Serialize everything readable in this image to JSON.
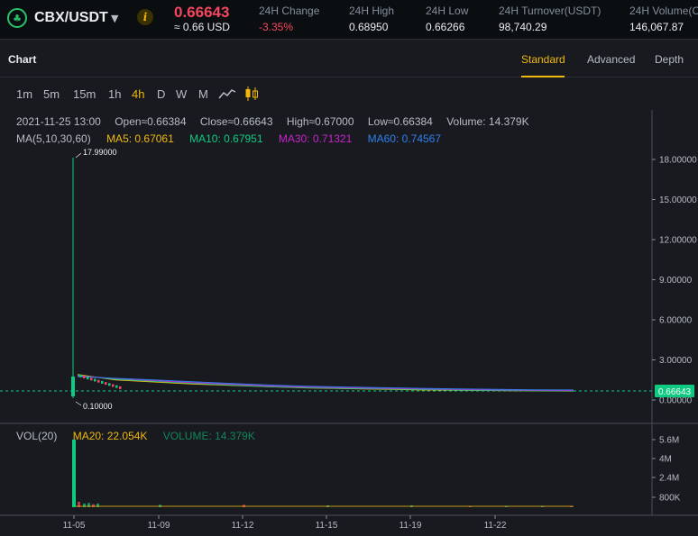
{
  "header": {
    "pair": "CBX/USDT",
    "pair_caret": "▼",
    "info_glyph": "i",
    "logo_glyph": "♣",
    "last_price": "0.66643",
    "last_price_usd": "≈ 0.66 USD",
    "stats": [
      {
        "label": "24H Change",
        "value": "-3.35%"
      },
      {
        "label": "24H High",
        "value": "0.68950"
      },
      {
        "label": "24H Low",
        "value": "0.66266"
      },
      {
        "label": "24H Turnover(USDT)",
        "value": "98,740.29"
      },
      {
        "label": "24H Volume(C",
        "value": "146,067.87"
      }
    ],
    "colors": {
      "up": "#0ecb81",
      "down": "#f6465d",
      "accent": "#f0b90b"
    }
  },
  "chart_panel": {
    "title": "Chart",
    "tabs": [
      "Standard",
      "Advanced",
      "Depth"
    ],
    "active_tab": "Standard"
  },
  "toolbar": {
    "intervals": [
      "1m",
      "5m",
      "15m",
      "1h",
      "4h",
      "D",
      "W",
      "M"
    ],
    "active_interval": "4h",
    "icons": [
      "line-chart-icon",
      "candlestick-icon"
    ]
  },
  "legend": {
    "time": "2021-11-25 13:00",
    "open": "Open≈0.66384",
    "close": "Close≈0.66643",
    "high": "High≈0.67000",
    "low": "Low≈0.66384",
    "volume": "Volume: 14.379K",
    "ma_label": "MA(5,10,30,60)",
    "ma5": "MA5: 0.67061",
    "ma10": "MA10: 0.67951",
    "ma30": "MA30: 0.71321",
    "ma60": "MA60: 0.74567",
    "ma_colors": {
      "ma5": "#f0b90b",
      "ma10": "#0ecb81",
      "ma30": "#c924c9",
      "ma60": "#2f80ed"
    }
  },
  "volume_legend": {
    "label": "VOL(20)",
    "ma20": "MA20: 22.054K",
    "volume": "VOLUME: 14.379K"
  },
  "chart_data": {
    "type": "line",
    "price_axis": {
      "ticks": [
        "18.00000",
        "15.00000",
        "12.00000",
        "9.00000",
        "6.00000",
        "3.00000",
        "0.00000"
      ],
      "range": [
        0,
        18
      ]
    },
    "volume_axis": {
      "ticks": [
        "5.6M",
        "4M",
        "2.4M",
        "800K"
      ]
    },
    "x_ticks": [
      "11-05",
      "11-09",
      "11-12",
      "11-15",
      "11-19",
      "11-22"
    ],
    "max_marker": "17.99000",
    "min_marker": "0.10000",
    "current_price_label": "0.66643",
    "series": [
      {
        "name": "MA5",
        "values": [
          1.9,
          1.5,
          1.35,
          1.2,
          1.1,
          1.0,
          0.9,
          0.85,
          0.8,
          0.75,
          0.72,
          0.7,
          0.68,
          0.67
        ]
      },
      {
        "name": "MA10",
        "values": [
          1.85,
          1.55,
          1.4,
          1.25,
          1.12,
          1.0,
          0.92,
          0.87,
          0.82,
          0.78,
          0.74,
          0.71,
          0.69,
          0.68
        ]
      },
      {
        "name": "MA30",
        "values": [
          1.8,
          1.6,
          1.45,
          1.3,
          1.18,
          1.05,
          0.97,
          0.92,
          0.87,
          0.82,
          0.78,
          0.75,
          0.73,
          0.71
        ]
      },
      {
        "name": "MA60",
        "values": [
          1.75,
          1.62,
          1.5,
          1.36,
          1.24,
          1.12,
          1.03,
          0.97,
          0.92,
          0.87,
          0.83,
          0.79,
          0.76,
          0.75
        ]
      }
    ],
    "volume_bars": [
      5.6,
      0.45,
      0.3,
      0.35,
      0.25,
      0.3,
      0.2,
      0.2,
      0.15,
      0.15,
      0.1,
      0.1,
      0.1,
      0.05
    ]
  }
}
